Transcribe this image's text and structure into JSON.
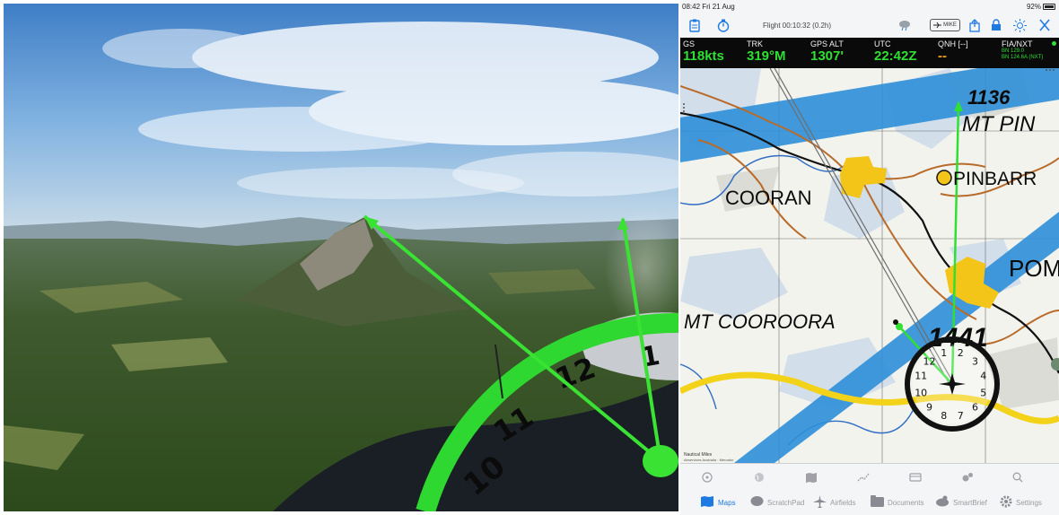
{
  "photo": {
    "clock_numbers": [
      "10",
      "11",
      "12",
      "1"
    ]
  },
  "ipad": {
    "status": {
      "time": "08:42 Fri 21 Aug",
      "battery": "92%"
    },
    "toolbar": {
      "flight_label": "Flight 00:10:32 (0.2h)",
      "mike_label": "MIKE",
      "icons": [
        "clipboard-icon",
        "stopwatch-icon",
        "weather-icon",
        "share-icon",
        "lock-icon",
        "brightness-icon",
        "close-icon"
      ]
    },
    "datastrip": {
      "gs_label": "GS",
      "gs_value": "118kts",
      "trk_label": "TRK",
      "trk_value": "319°M",
      "alt_label": "GPS ALT",
      "alt_value": "1307'",
      "utc_label": "UTC",
      "utc_value": "22:42Z",
      "qnh_label": "QNH [--]",
      "qnh_value": "--",
      "fia_label": "FIA/NXT",
      "fia_line1": "BN 129.0",
      "fia_line2": "BN 124.6A (NXT)"
    },
    "map": {
      "labels": {
        "cooran": "COORAN",
        "pinbarren": "PINBARR",
        "pomona": "POM",
        "mt_pinbarren": "MT PIN",
        "mt_cooroora": "MT COOROORA",
        "elev_1136": "1136",
        "elev_1441": "1441"
      },
      "clock_numbers": [
        "12",
        "1",
        "2",
        "3",
        "4",
        "5",
        "6",
        "7",
        "8",
        "9",
        "10",
        "11"
      ],
      "scale_text": "Nautical Miles",
      "attribution": "Airservices Australia · Mercator"
    },
    "sub_icons": [
      "compass-icon",
      "globe-icon",
      "map-icon",
      "route-icon",
      "card-icon",
      "gears-icon",
      "search-icon"
    ],
    "tabs": [
      {
        "label": "Maps",
        "icon": "map-icon",
        "active": true
      },
      {
        "label": "ScratchPad",
        "icon": "scratchpad-icon",
        "active": false
      },
      {
        "label": "Airfields",
        "icon": "airplane-icon",
        "active": false
      },
      {
        "label": "Documents",
        "icon": "documents-icon",
        "active": false
      },
      {
        "label": "SmartBrief",
        "icon": "smartbrief-icon",
        "active": false
      },
      {
        "label": "Settings",
        "icon": "settings-icon",
        "active": false
      }
    ],
    "colors": {
      "accent": "#1e7ae3",
      "green": "#2fe032",
      "qnh": "#f0a020"
    }
  }
}
